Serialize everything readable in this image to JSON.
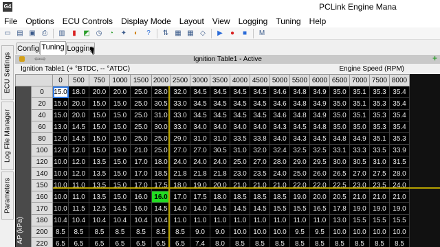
{
  "window": {
    "title": "PCLink Engine Mana",
    "app_icon_text": "G4"
  },
  "menu": [
    "File",
    "Options",
    "ECU Controls",
    "Display Mode",
    "Layout",
    "View",
    "Logging",
    "Tuning",
    "Help"
  ],
  "toolbar_icons": [
    "new-icon",
    "open-icon",
    "save-icon",
    "print-icon",
    "sep",
    "stats-icon",
    "bars-icon",
    "chart-icon",
    "clock-icon",
    "gauge-icon",
    "tools-icon",
    "color-icon",
    "help-icon",
    "sep",
    "ecu-connect-icon",
    "ecu-icon",
    "ecu-store-icon",
    "eraser-icon",
    "sep",
    "play-icon",
    "record-icon",
    "stop-icon",
    "sep",
    "marker-icon"
  ],
  "side_tabs": [
    "ECU Settings",
    "Log File Manager",
    "Parameters"
  ],
  "tabs": [
    "Config",
    "Tuning",
    "Logging"
  ],
  "active_tab": "Tuning",
  "panel": {
    "title": "Ignition Table1 - Active"
  },
  "table": {
    "name": "Ignition Table1 (+ °BTDC, -- °ATDC)",
    "x_axis_label": "Engine Speed (RPM)",
    "y_axis_label": "AP (kPa)",
    "columns": [
      "0",
      "500",
      "750",
      "1000",
      "1500",
      "2000",
      "2500",
      "3000",
      "3500",
      "4000",
      "4500",
      "5000",
      "5500",
      "6000",
      "6500",
      "7000",
      "7500",
      "8000"
    ],
    "rows": [
      {
        "h": "0",
        "v": [
          "15.0",
          "18.0",
          "20.0",
          "20.0",
          "25.0",
          "28.0",
          "32.0",
          "34.5",
          "34.5",
          "34.5",
          "34.5",
          "34.6",
          "34.8",
          "34.9",
          "35.0",
          "35.1",
          "35.3",
          "35.4",
          "35.5"
        ]
      },
      {
        "h": "20",
        "v": [
          "15.0",
          "20.0",
          "15.0",
          "15.0",
          "25.0",
          "30.5",
          "33.0",
          "34.5",
          "34.5",
          "34.5",
          "34.5",
          "34.6",
          "34.8",
          "34.9",
          "35.0",
          "35.1",
          "35.3",
          "35.4",
          "35.5"
        ]
      },
      {
        "h": "40",
        "v": [
          "15.0",
          "20.0",
          "15.0",
          "15.0",
          "25.0",
          "31.0",
          "33.0",
          "34.5",
          "34.5",
          "34.5",
          "34.5",
          "34.6",
          "34.8",
          "34.9",
          "35.0",
          "35.1",
          "35.3",
          "35.4",
          "35.5"
        ]
      },
      {
        "h": "60",
        "v": [
          "13.0",
          "14.5",
          "15.0",
          "15.0",
          "25.0",
          "30.0",
          "33.0",
          "34.0",
          "34.0",
          "34.0",
          "34.0",
          "34.3",
          "34.5",
          "34.8",
          "35.0",
          "35.0",
          "35.3",
          "35.4",
          "35.5"
        ]
      },
      {
        "h": "80",
        "v": [
          "12.0",
          "14.5",
          "15.0",
          "15.0",
          "25.0",
          "25.0",
          "29.0",
          "31.0",
          "31.0",
          "33.5",
          "33.8",
          "34.0",
          "34.3",
          "34.5",
          "34.8",
          "34.9",
          "35.1",
          "35.3",
          "35.5"
        ]
      },
      {
        "h": "100",
        "v": [
          "12.0",
          "12.0",
          "15.0",
          "19.0",
          "21.0",
          "25.0",
          "27.0",
          "27.0",
          "30.5",
          "31.0",
          "32.0",
          "32.4",
          "32.5",
          "32.5",
          "33.1",
          "33.3",
          "33.5",
          "33.9",
          "34.3"
        ]
      },
      {
        "h": "120",
        "v": [
          "10.0",
          "12.0",
          "13.5",
          "15.0",
          "17.0",
          "18.0",
          "24.0",
          "24.0",
          "24.0",
          "25.0",
          "27.0",
          "28.0",
          "29.0",
          "29.5",
          "30.0",
          "30.5",
          "31.0",
          "31.5",
          "32.0"
        ]
      },
      {
        "h": "140",
        "v": [
          "10.0",
          "12.0",
          "13.5",
          "15.0",
          "17.0",
          "18.5",
          "21.8",
          "21.8",
          "21.8",
          "23.0",
          "23.5",
          "24.0",
          "25.0",
          "26.0",
          "26.5",
          "27.0",
          "27.5",
          "28.0",
          "28.5"
        ]
      },
      {
        "h": "150",
        "v": [
          "10.0",
          "11.0",
          "13.5",
          "15.0",
          "17.0",
          "17.5",
          "18.0",
          "19.0",
          "20.0",
          "21.0",
          "21.0",
          "21.0",
          "22.0",
          "22.0",
          "22.5",
          "23.0",
          "23.5",
          "24.0",
          "24.5"
        ]
      },
      {
        "h": "160",
        "v": [
          "10.0",
          "11.0",
          "13.5",
          "15.0",
          "16.0",
          "16.0",
          "17.0",
          "17.5",
          "18.0",
          "18.5",
          "18.5",
          "18.5",
          "19.0",
          "20.0",
          "20.5",
          "21.0",
          "21.0",
          "21.0",
          "21.0"
        ]
      },
      {
        "h": "170",
        "v": [
          "10.0",
          "11.5",
          "12.5",
          "14.5",
          "16.0",
          "14.5",
          "14.0",
          "14.0",
          "14.5",
          "14.5",
          "14.5",
          "15.5",
          "15.5",
          "16.5",
          "17.8",
          "19.0",
          "19.0",
          "19.0",
          "19.0"
        ]
      },
      {
        "h": "180",
        "v": [
          "10.4",
          "10.4",
          "10.4",
          "10.4",
          "10.4",
          "10.4",
          "11.0",
          "11.0",
          "11.0",
          "11.0",
          "11.0",
          "11.0",
          "11.0",
          "11.0",
          "13.0",
          "15.5",
          "15.5",
          "15.5",
          "15.5"
        ]
      },
      {
        "h": "200",
        "v": [
          "8.5",
          "8.5",
          "8.5",
          "8.5",
          "8.5",
          "8.5",
          "8.5",
          "9.0",
          "9.0",
          "10.0",
          "10.0",
          "10.0",
          "9.5",
          "9.5",
          "10.0",
          "10.0",
          "10.0",
          "10.0",
          "10.0"
        ]
      },
      {
        "h": "220",
        "v": [
          "6.5",
          "6.5",
          "6.5",
          "6.5",
          "6.5",
          "6.5",
          "6.5",
          "7.4",
          "8.0",
          "8.5",
          "8.5",
          "8.5",
          "8.5",
          "8.5",
          "8.5",
          "8.5",
          "8.5",
          "8.5",
          "8.5"
        ]
      }
    ],
    "selected_cell": [
      0,
      0
    ],
    "active_cell": [
      9,
      5
    ]
  }
}
